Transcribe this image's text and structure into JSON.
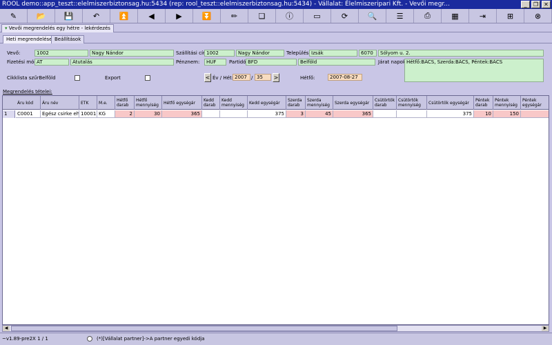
{
  "window": {
    "title": "ROOL demo::app_teszt::elelmiszerbiztonsag.hu:5434 (rep: rool_teszt::elelmiszerbiztonsag.hu:5434) - Vállalat: Élelmiszeripari Kft. - Vevői megr...",
    "minimize_glyph": "_",
    "restore_glyph": "❐",
    "close_glyph": "✕"
  },
  "toolbar": {
    "buttons": [
      {
        "icon": "edit-icon",
        "glyph": "✎"
      },
      {
        "icon": "open-icon",
        "glyph": "📂"
      },
      {
        "icon": "save-icon",
        "glyph": "💾"
      },
      {
        "icon": "undo-icon",
        "glyph": "↶"
      },
      {
        "icon": "first-icon",
        "glyph": "⏫"
      },
      {
        "icon": "prev-icon",
        "glyph": "◀"
      },
      {
        "icon": "next-icon",
        "glyph": "▶"
      },
      {
        "icon": "last-icon",
        "glyph": "⏬"
      },
      {
        "icon": "note-icon",
        "glyph": "✏"
      },
      {
        "icon": "copy-icon",
        "glyph": "❏"
      },
      {
        "icon": "info-icon",
        "glyph": "ⓘ"
      },
      {
        "icon": "window-icon",
        "glyph": "▭"
      },
      {
        "icon": "refresh-icon",
        "glyph": "⟳"
      },
      {
        "icon": "search-icon",
        "glyph": "🔍"
      },
      {
        "icon": "list-icon",
        "glyph": "☰"
      },
      {
        "icon": "print-icon",
        "glyph": "⎙"
      },
      {
        "icon": "table-icon",
        "glyph": "▦"
      },
      {
        "icon": "export-icon",
        "glyph": "⇥"
      },
      {
        "icon": "grid-icon",
        "glyph": "⊞"
      },
      {
        "icon": "close-icon",
        "glyph": "⊗"
      }
    ]
  },
  "module_tab": {
    "label": "Vevői megrendelés egy hétre - lekérdezés"
  },
  "sub_tabs": [
    {
      "label": "Heti megrendelések"
    },
    {
      "label": "Beállítások"
    }
  ],
  "form": {
    "vevo_label": "Vevő:",
    "vevo_code": "1002",
    "vevo_name": "Nagy Nándor",
    "szallitasi_cim_label": "Szállítási cím:",
    "szallitasi_code": "1002",
    "szallitasi_name": "Nagy Nándor",
    "telepules_label": "Település:",
    "telepules": "Izsák",
    "irsz": "6070",
    "cim": "Sólyom u. 2.",
    "fizetesi_mod_label": "Fizetési mód:",
    "fizetesi_mod_code": "AT",
    "fizetesi_mod_name": "Átutalás",
    "penznem_label": "Pénznem:",
    "penznem": "HUF",
    "partido_label": "Partidó:",
    "partido_code": "BFD",
    "partido_name": "Belföld",
    "jarat_napok_label": "Járat napok:",
    "jarat_napok": "Hétfő:BÁCS, Szerda:BÁCS, Péntek:BÁCS",
    "cikklista_label": "Cikklista szűrBelföld",
    "export_label": "Export",
    "ev_het_label": "Év / Hét:",
    "ev": "2007",
    "slash": "/",
    "het": "35",
    "prev_glyph": "<",
    "next_glyph": ">",
    "hetfo_label": "Hétfő:",
    "hetfo_date": "2007-08-27"
  },
  "grid": {
    "title": "Megrendelés tételei:",
    "columns": [
      "Áru kód",
      "Áru név",
      "ETK",
      "M.e.",
      "Hétfő darab",
      "Hétfő mennyiség",
      "Hétfő egységár",
      "Kedd darab",
      "Kedd mennyiség",
      "Kedd egységár",
      "Szerda darab",
      "Szerda mennyiség",
      "Szerda egységár",
      "Csütörtök darab",
      "Csütörtök mennyiség",
      "Csütörtök egységár",
      "Péntek darab",
      "Péntek mennyiség",
      "Péntek egységár"
    ],
    "rows": [
      {
        "row_no": "1",
        "cells": [
          "C0001",
          "Egész csirke eh.",
          "10001",
          "KG",
          "2",
          "30",
          "365",
          "",
          "",
          "375",
          "3",
          "45",
          "365",
          "",
          "",
          "375",
          "10",
          "150",
          ""
        ]
      }
    ]
  },
  "hscroll": {
    "left_glyph": "◀",
    "right_glyph": "▶"
  },
  "status": {
    "version": "~v1.89-pre2X 1 / 1",
    "message": "(*)[Vállalat partner]->A partner egyedi kódja"
  }
}
